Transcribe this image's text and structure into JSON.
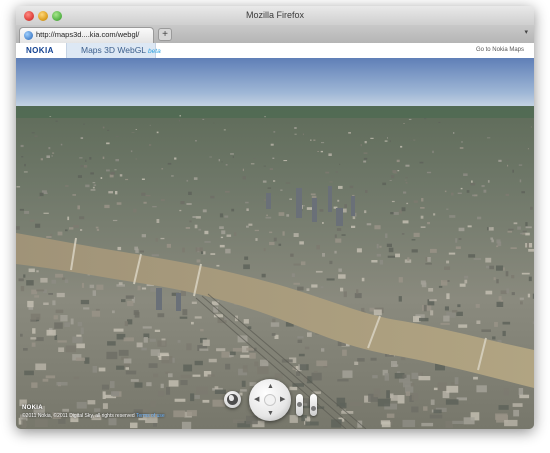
{
  "browser": {
    "window_title": "Mozilla Firefox",
    "tab": {
      "label": "http://maps3d....kia.com/webgl/",
      "favicon": "globe-icon"
    },
    "new_tab_label": "+",
    "tab_list_label": "▾"
  },
  "header": {
    "logo_text": "NOKIA",
    "app_title": "Maps 3D WebGL",
    "app_badge": "beta",
    "link_label": "Go to Nokia Maps"
  },
  "map": {
    "logo_text": "NOKIA",
    "copyright_text": "©2011 Nokia, ©2011 Digital Sky, all rights reserved",
    "terms_label": "Terms of use",
    "controls": {
      "globe": "globe-icon",
      "pan": "pan-compass-icon",
      "zoom": "zoom-slider",
      "tilt": "tilt-slider"
    }
  },
  "colors": {
    "nokia_blue": "#124191",
    "sky_top": "#5f7fb7",
    "river": "#9c9071"
  }
}
